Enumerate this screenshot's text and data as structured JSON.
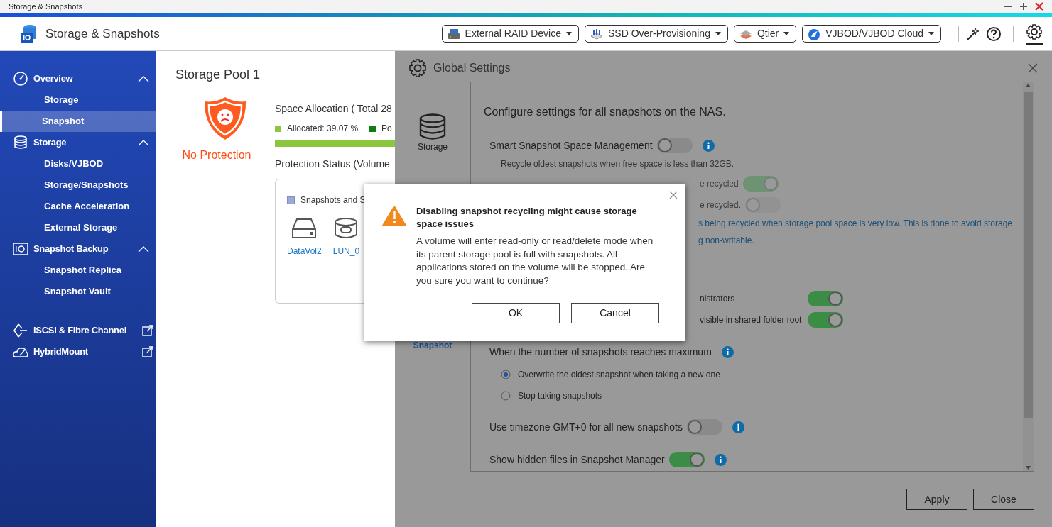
{
  "window": {
    "title": "Storage & Snapshots"
  },
  "header": {
    "title": "Storage & Snapshots",
    "tools": [
      {
        "label": "External RAID Device"
      },
      {
        "label": "SSD Over-Provisioning"
      },
      {
        "label": "Qtier"
      },
      {
        "label": "VJBOD/VJBOD Cloud"
      }
    ]
  },
  "sidebar": {
    "items": [
      {
        "kind": "group",
        "label": "Overview",
        "expanded": true,
        "children": [
          {
            "label": "Storage",
            "selected": false
          },
          {
            "label": "Snapshot",
            "selected": true
          }
        ]
      },
      {
        "kind": "group",
        "label": "Storage",
        "expanded": true,
        "children": [
          {
            "label": "Disks/VJBOD",
            "selected": false
          },
          {
            "label": "Storage/Snapshots",
            "selected": false
          },
          {
            "label": "Cache Acceleration",
            "selected": false
          },
          {
            "label": "External Storage",
            "selected": false
          }
        ]
      },
      {
        "kind": "group",
        "label": "Snapshot Backup",
        "expanded": true,
        "children": [
          {
            "label": "Snapshot Replica",
            "selected": false
          },
          {
            "label": "Snapshot Vault",
            "selected": false
          }
        ]
      },
      {
        "kind": "link",
        "label": "iSCSI & Fibre Channel"
      },
      {
        "kind": "link",
        "label": "HybridMount"
      }
    ]
  },
  "pool": {
    "title": "Storage Pool 1",
    "protection": "No Protection",
    "space_title": "Space Allocation ( Total 28",
    "legend": [
      {
        "label": "Allocated: 39.07 %",
        "color": "#8cc63f"
      },
      {
        "label": "Po",
        "color": "#0f7d14"
      }
    ],
    "allocation": {
      "level": 0.3907
    },
    "status_title": "Protection Status (Volume",
    "status_legend": "Snapshots and S",
    "volumes": [
      {
        "kind": "disk",
        "name": "DataVol2"
      },
      {
        "kind": "lun",
        "name": "LUN_0"
      }
    ]
  },
  "settings_panel": {
    "title": "Global Settings",
    "nav": [
      {
        "label": "Storage",
        "selected": false
      },
      {
        "label": "Snapshot",
        "selected": true
      }
    ],
    "intro": "Configure settings for all snapshots on the NAS.",
    "settings": [
      {
        "kind": "toggle",
        "label": "Smart Snapshot Space Management",
        "on": false
      },
      {
        "kind": "note",
        "text": "Recycle oldest snapshots when free space is less than 32GB."
      },
      {
        "kind": "subtoggle",
        "label": "e recycled",
        "on": true,
        "disabled": true
      },
      {
        "kind": "subtoggle",
        "label": "e recycled.",
        "on": false,
        "disabled": true
      },
      {
        "kind": "warning",
        "text": "s being recycled when storage pool space is very low. This is done to avoid storage"
      },
      {
        "kind": "warning",
        "text": "g non-writable."
      },
      {
        "kind": "subtoggle",
        "label": "nistrators",
        "on": true,
        "disabled": false
      },
      {
        "kind": "subtoggle",
        "label": "visible in shared folder root",
        "on": true,
        "disabled": false
      },
      {
        "kind": "heading",
        "label": "When the number of snapshots reaches maximum"
      },
      {
        "kind": "radio",
        "label": "Overwrite the oldest snapshot when taking a new one",
        "selected": true
      },
      {
        "kind": "radio",
        "label": "Stop taking snapshots",
        "selected": false
      },
      {
        "kind": "toggle",
        "label": "Use timezone GMT+0 for all new snapshots",
        "on": false
      },
      {
        "kind": "toggle",
        "label": "Show hidden files in Snapshot Manager",
        "on": true
      }
    ],
    "buttons": [
      "Apply",
      "Close"
    ]
  },
  "dialog": {
    "title": "Disabling snapshot recycling might cause storage space issues",
    "message": "A volume will enter read-only or read/delete mode when its parent storage pool is full with snapshots. All applications stored on the volume will be stopped. Are you sure you want to continue?",
    "buttons": [
      "OK",
      "Cancel"
    ]
  }
}
